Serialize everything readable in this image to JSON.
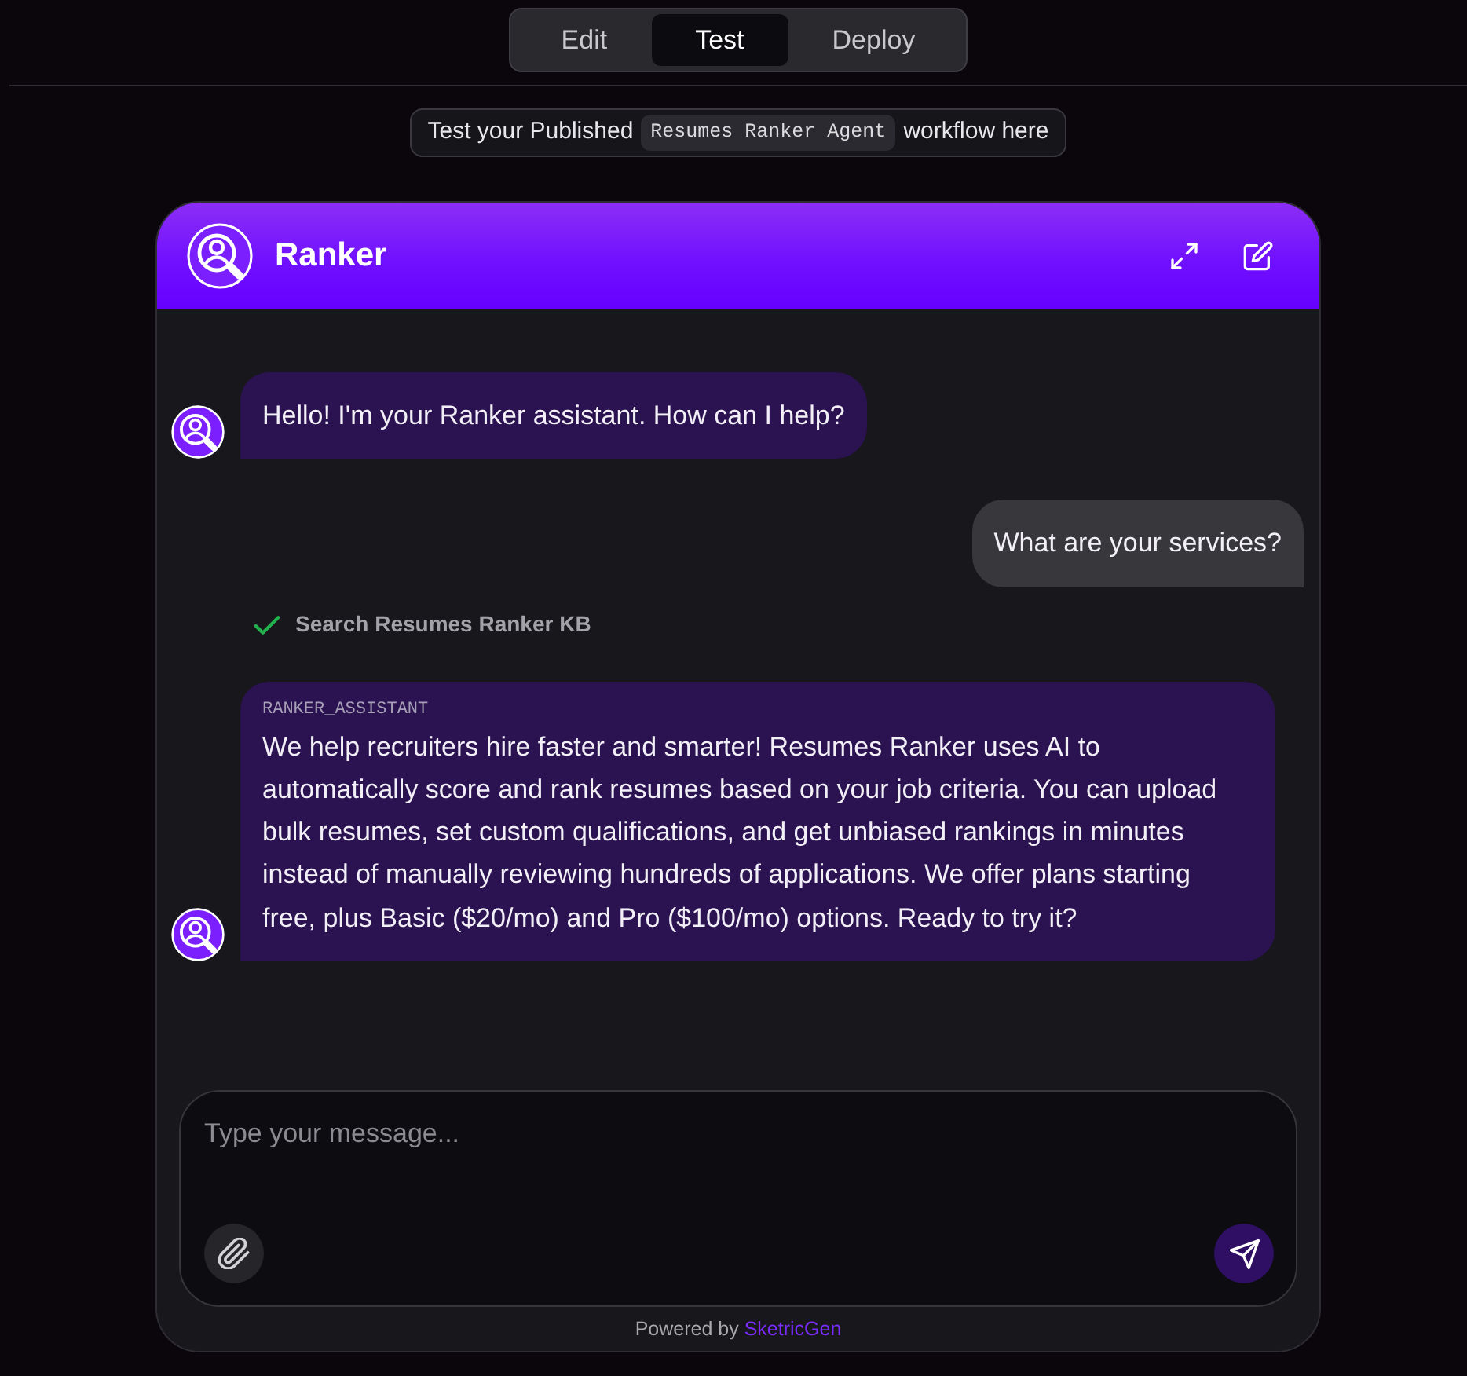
{
  "tabs": [
    {
      "label": "Edit",
      "selected": false
    },
    {
      "label": "Test",
      "selected": true
    },
    {
      "label": "Deploy",
      "selected": false
    }
  ],
  "banner": {
    "text_before": "Test your Published",
    "workflow_name": "Resumes Ranker Agent",
    "text_after": "workflow here"
  },
  "chat": {
    "title": "Ranker",
    "messages": [
      {
        "kind": "bot",
        "text": "Hello! I'm your Ranker assistant. How can I help?"
      },
      {
        "kind": "user",
        "text": "What are your services?"
      },
      {
        "kind": "tool",
        "text": "Search Resumes Ranker KB",
        "done": true
      },
      {
        "kind": "bot",
        "sender": "RANKER_ASSISTANT",
        "text": "We help recruiters hire faster and smarter! Resumes Ranker uses AI to automatically score and rank resumes based on your job criteria. You can upload bulk resumes, set custom qualifications, and get unbiased rankings in minutes instead of manually reviewing hundreds of applications. We offer plans starting free, plus Basic ($20/mo) and Pro ($100/mo) options. Ready to try it?"
      }
    ]
  },
  "composer": {
    "placeholder": "Type your message..."
  },
  "footer": {
    "text": "Powered by",
    "brand": "SketricGen"
  }
}
